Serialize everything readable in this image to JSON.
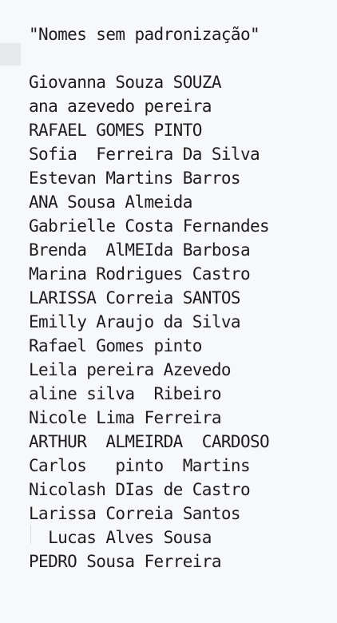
{
  "editor": {
    "lines": [
      "\"Nomes sem padronização\"",
      "",
      "Giovanna Souza SOUZA",
      "ana azevedo pereira",
      "RAFAEL GOMES PINTO",
      "Sofia  Ferreira Da Silva",
      "Estevan Martins Barros",
      "ANA Sousa Almeida",
      "Gabrielle Costa Fernandes",
      "Brenda  AlMEIda Barbosa",
      "Marina Rodrigues Castro",
      "LARISSA Correia SANTOS",
      "Emilly Araujo da Silva",
      "Rafael Gomes pinto",
      "Leila pereira Azevedo",
      "aline silva  Ribeiro",
      "Nicole Lima Ferreira",
      "ARTHUR  ALMEIRDA  CARDOSO",
      "Carlos   pinto  Martins",
      "Nicolash DIas de Castro",
      "Larissa Correia Santos",
      "  Lucas Alves Sousa",
      "PEDRO Sousa Ferreira"
    ]
  }
}
